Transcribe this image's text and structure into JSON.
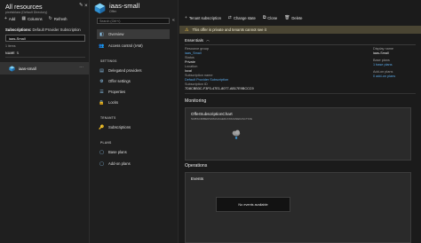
{
  "left": {
    "title": "All resources",
    "subtitle": "pixelsblara (Default Directory)",
    "toolbar": {
      "add": "Add",
      "columns": "Columns",
      "refresh": "Refresh"
    },
    "subscriptions_label": "Subscriptions:",
    "subscriptions_value": "Default Provider Subscription",
    "filter_value": "iaas-Small",
    "count": "1 items",
    "column_header": "NAME",
    "rows": [
      {
        "name": "iaas-small"
      }
    ]
  },
  "mid": {
    "title": "iaas-small",
    "subtitle": "Offer",
    "search_placeholder": "Search (Ctrl+/)",
    "nav": {
      "overview": "Overview",
      "access_control": "Access control (IAM)",
      "settings_section": "SETTINGS",
      "delegated_providers": "Delegated providers",
      "offer_settings": "Offer settings",
      "properties": "Properties",
      "locks": "Locks",
      "tenants_section": "TENANTS",
      "subscriptions": "Subscriptions",
      "plans_section": "PLANS",
      "base_plans": "Base plans",
      "addon_plans": "Add-on plans"
    }
  },
  "right": {
    "toolbar": {
      "tenant_subscription": "Tenant subscription",
      "change_state": "Change state",
      "clone": "Clone",
      "delete": "Delete"
    },
    "warning": "This offer is private and tenants cannot see it",
    "essentials": "Essentials",
    "fields": {
      "resource_group_label": "Resource group",
      "resource_group_value": "iaas_Small",
      "status_label": "Status",
      "status_value": "Private",
      "location_label": "Location",
      "location_value": "local",
      "subscription_label": "Subscription name",
      "subscription_value": "Default Provider Subscription",
      "subscription_id_label": "Subscription ID",
      "subscription_id_value": "7D8CBB3C-F3F0-47E1-8077-AB17E9BCCC9",
      "display_name_label": "Display name",
      "display_name_value": "iaas-Small",
      "base_plans_label": "Base plans",
      "base_plans_value": "1 base plans",
      "addon_plans_label": "Add-on plans",
      "addon_plans_value": "0 add-on plans"
    },
    "monitoring": "Monitoring",
    "chart_title": "OfferSubscriptionChart",
    "chart_subtitle": "SUBSCRIBERS/MANAGED/ASSIGNED/ACTIVE",
    "operations": "Operations",
    "events_title": "Events",
    "no_events": "No events available"
  },
  "colors": {
    "accent_link": "#5aa8e6",
    "warning_bg": "#4a4533",
    "warning_icon": "#f4c74a",
    "selected_row": "#333333"
  }
}
